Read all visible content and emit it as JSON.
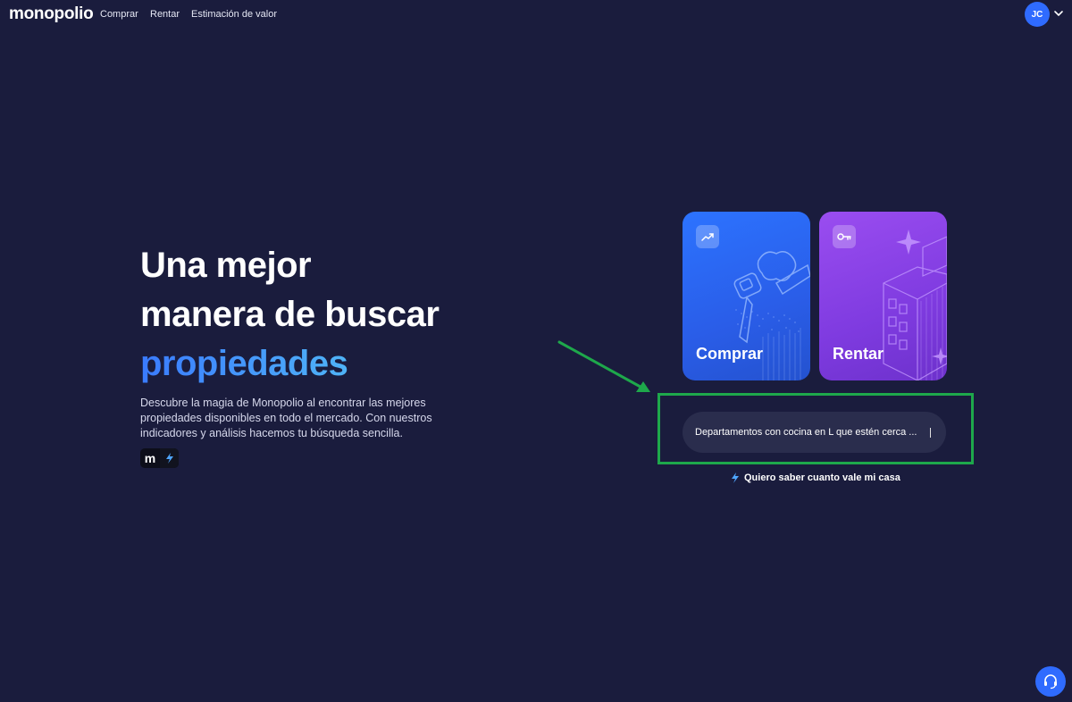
{
  "nav": {
    "logo": "monopolio",
    "links": [
      "Comprar",
      "Rentar",
      "Estimación de valor"
    ],
    "avatar_initials": "JC"
  },
  "hero": {
    "title_line1": "Una mejor",
    "title_line2": "manera de buscar",
    "title_accent": "propiedades",
    "description": "Descubre la magia de Monopolio al encontrar las mejores propiedades disponibles en todo el mercado. Con nuestros indicadores y análisis hacemos tu búsqueda sencilla.",
    "badge_letter": "m"
  },
  "cards": {
    "buy_label": "Comprar",
    "rent_label": "Rentar"
  },
  "search": {
    "value": "Departamentos con cocina en L que estén cerca ..."
  },
  "valuation_link": "Quiero saber cuanto vale mi casa",
  "colors": {
    "background": "#1a1c3d",
    "accent_blue": "#2f6bff",
    "buy_card": "#2c73ff",
    "rent_card": "#9a4df0",
    "highlight": "#1ea84b"
  },
  "icons": {
    "buy": "trending-up-icon",
    "rent": "key-icon",
    "bolt": "lightning-bolt-icon",
    "help": "support-agent-icon",
    "chevron": "chevron-down-icon"
  }
}
